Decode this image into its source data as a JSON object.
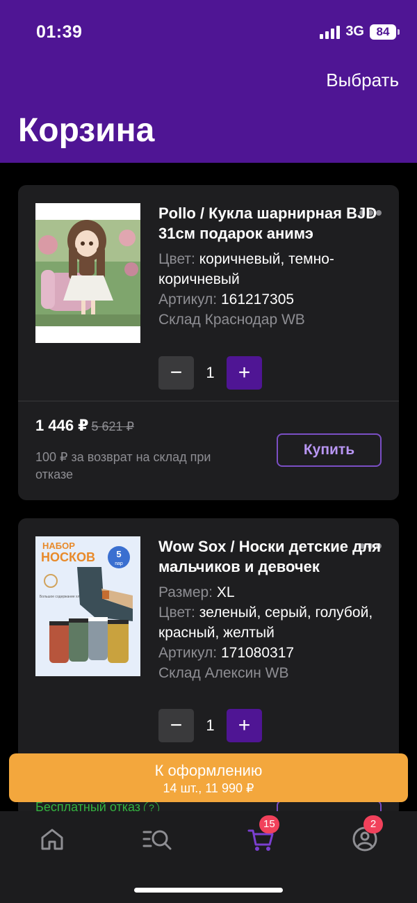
{
  "status": {
    "time": "01:39",
    "network": "3G",
    "battery": "84"
  },
  "header": {
    "action": "Выбрать",
    "title": "Корзина"
  },
  "items": [
    {
      "title": "Pollo / Кукла шарнирная BJD 31см подарок анимэ",
      "color_label": "Цвет:",
      "color_value": "коричневый, темно-коричневый",
      "article_label": "Артикул:",
      "article_value": "161217305",
      "warehouse": "Склад Краснодар WB",
      "quantity": "1",
      "price": "1 446 ₽",
      "old_price": "5 621 ₽",
      "note": "100 ₽ за возврат на склад при отказе",
      "buy_label": "Купить"
    },
    {
      "title": "Wow Sox / Носки детские для мальчиков и девочек",
      "size_label": "Размер:",
      "size_value": "XL",
      "color_label": "Цвет:",
      "color_value": "зеленый, серый, голубой, красный, желтый",
      "article_label": "Артикул:",
      "article_value": "171080317",
      "warehouse": "Склад Алексин WB",
      "quantity": "1",
      "free_cancel": "Бесплатный отказ",
      "help": "?",
      "image_text": {
        "line1": "НАБОР",
        "line2": "НОСКОВ",
        "pairs_num": "5",
        "pairs_word": "пар",
        "cotton": "Большое содержание хлопка"
      }
    }
  ],
  "checkout": {
    "label": "К оформлению",
    "summary": "14 шт., 11 990 ₽"
  },
  "tabbar": {
    "cart_badge": "15",
    "profile_badge": "2"
  },
  "colors": {
    "brand": "#4f1594",
    "checkout": "#f3a73d",
    "badge": "#f1415b",
    "free": "#33b33f"
  }
}
